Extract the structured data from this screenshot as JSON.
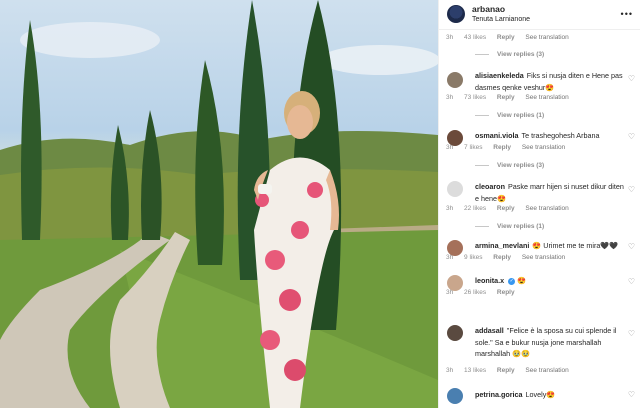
{
  "post": {
    "username": "arbanao",
    "location": "Tenuta Larnianone"
  },
  "header_comment": {
    "age": "3h",
    "likes": "43 likes",
    "reply": "Reply",
    "translation": "See translation",
    "view_replies": "View replies (3)"
  },
  "comments": [
    {
      "username": "alisiaenkeleda",
      "text": "Fiks si nusja diten e Hene pas dasmes qenke veshur😍",
      "age": "3h",
      "likes": "73 likes",
      "reply": "Reply",
      "translation": "See translation",
      "view_replies": "View replies (1)"
    },
    {
      "username": "osmani.viola",
      "text": "Te trashegohesh Arbana",
      "age": "3h",
      "likes": "7 likes",
      "reply": "Reply",
      "translation": "See translation",
      "view_replies": "View replies (3)"
    },
    {
      "username": "cleoaron",
      "text": "Paske marr hijen si nuset dikur diten e hene😍",
      "age": "3h",
      "likes": "22 likes",
      "reply": "Reply",
      "translation": "See translation",
      "view_replies": "View replies (1)"
    },
    {
      "username": "armina_mevlani",
      "text": "😍 Urimet me te mira🖤🖤",
      "age": "3h",
      "likes": "9 likes",
      "reply": "Reply",
      "translation": "See translation"
    },
    {
      "username": "leonita.x",
      "text": "😍",
      "age": "3h",
      "likes": "26 likes",
      "reply": "Reply"
    },
    {
      "username": "addasall",
      "text": "\"Felice è la sposa su cui splende il sole.\" Sa e bukur nusja jone marshallah marshallah 🥹🥹",
      "age": "3h",
      "likes": "13 likes",
      "reply": "Reply",
      "translation": "See translation"
    },
    {
      "username": "petrina.gorica",
      "text": "Lovely😍"
    }
  ],
  "icons": {
    "more": "more-icon",
    "heart": "heart-icon",
    "verified": "verified-icon"
  },
  "colors": {
    "text": "#262626",
    "secondary": "#8e8e8e",
    "verified": "#3897f0"
  }
}
